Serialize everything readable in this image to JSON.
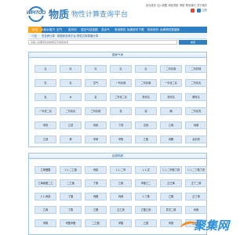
{
  "header": {
    "logo_text": "WPITOO",
    "site_name": "物质",
    "site_sub": "物性计算查询平台",
    "top_links": [
      "设为首页",
      "加入收藏",
      "网站导航",
      "帮助",
      "联系我们",
      "关于我们"
    ],
    "login_label": "注册"
  },
  "nav": {
    "items": [
      "首页",
      "水和水蒸汽",
      "空气",
      "制冷剂",
      "湿空气焓湿图",
      "混合气",
      "常用物性",
      "免费软件下载",
      "购买软件",
      "经典物性数据库"
    ]
  },
  "subnav": {
    "items": [
      "介绍",
      "安全阀计算",
      "数据库查询平台",
      "物性式换算器计算"
    ]
  },
  "search": {
    "placeholder": "请输入您要查找的物质名字或者常用",
    "button_label": "搜索"
  },
  "panel1": {
    "title": "国家气体",
    "rows": [
      [
        "氢",
        "氦",
        "氖",
        "氩",
        "氪",
        "二氧化碳",
        "二氧化硫"
      ],
      [
        "氧",
        "氮",
        "空气",
        "一氧化碳",
        "二氧化碳",
        "一氧化二氮",
        "二氧化氮"
      ],
      [
        "氨",
        "水",
        "氟",
        "二氧化二氮",
        "氯化氢",
        "溴化氢",
        "碘化氢"
      ],
      [
        "一氧化二氮",
        "二氧化氮",
        "三氧化硫",
        "氯",
        "溴",
        "碘",
        "二氧化氯"
      ],
      [
        "甲烷",
        "乙烷",
        "丙烷",
        "丁烷",
        "戊烷",
        "乙烯",
        "丙烯"
      ],
      [
        "乙炔",
        "苯",
        "甲苯",
        "甲醇",
        "乙醇",
        "丙酮",
        "氟利昂"
      ]
    ]
  },
  "panel2": {
    "title": "烃类物质",
    "rows": [
      [
        "乙苯醛酸",
        "1,1-二乙基",
        "丙腈",
        "1,1-二甲",
        "1,1-戊",
        "1,1-二甲基丁烷",
        "1,1-二丁基丁烷"
      ],
      [
        "乙苯萘酸二乙",
        "二乙基",
        "丁醇",
        "乙烯",
        "甲基乙二",
        "正己烯",
        "正丁二烯"
      ],
      [
        "1,1-丙炔",
        "丁醚",
        "丙醛",
        "丙烯",
        "1-丁基",
        "乙醚",
        "正丁烯"
      ],
      [
        "乙烯",
        "丁醇",
        "乙醛",
        "正乙烷",
        "乙酸乙烷",
        "异戊二烯",
        "丙烯"
      ],
      [
        "甲醇",
        "甲酸甲酯",
        "二乙醚",
        "甲酸",
        "乙基",
        "甲基",
        "正丙醇"
      ]
    ]
  },
  "watermark": {
    "text": "聚集网"
  },
  "colors": {
    "brand_blue": "#2e7fc4",
    "nav_active": "#f6a623",
    "cell_bg": "#dbe9f6",
    "watermark_orange": "#f28b1c"
  }
}
